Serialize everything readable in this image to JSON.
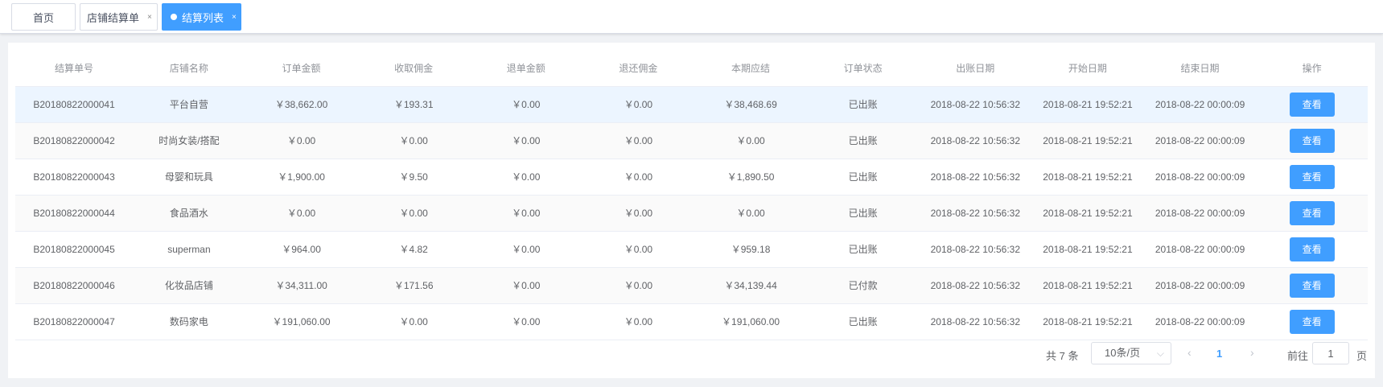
{
  "tabs": [
    {
      "label": "首页"
    },
    {
      "label": "店铺结算单",
      "close": "×"
    },
    {
      "label": "结算列表",
      "close": "×"
    }
  ],
  "table": {
    "headers": [
      "结算单号",
      "店铺名称",
      "订单金额",
      "收取佣金",
      "退单金额",
      "退还佣金",
      "本期应结",
      "订单状态",
      "出账日期",
      "开始日期",
      "结束日期",
      "操作"
    ],
    "rows": [
      [
        "B20180822000041",
        "平台自营",
        "￥38,662.00",
        "￥193.31",
        "￥0.00",
        "￥0.00",
        "￥38,468.69",
        "已出账",
        "2018-08-22 10:56:32",
        "2018-08-21 19:52:21",
        "2018-08-22 00:00:09"
      ],
      [
        "B20180822000042",
        "时尚女装/搭配",
        "￥0.00",
        "￥0.00",
        "￥0.00",
        "￥0.00",
        "￥0.00",
        "已出账",
        "2018-08-22 10:56:32",
        "2018-08-21 19:52:21",
        "2018-08-22 00:00:09"
      ],
      [
        "B20180822000043",
        "母婴和玩具",
        "￥1,900.00",
        "￥9.50",
        "￥0.00",
        "￥0.00",
        "￥1,890.50",
        "已出账",
        "2018-08-22 10:56:32",
        "2018-08-21 19:52:21",
        "2018-08-22 00:00:09"
      ],
      [
        "B20180822000044",
        "食品酒水",
        "￥0.00",
        "￥0.00",
        "￥0.00",
        "￥0.00",
        "￥0.00",
        "已出账",
        "2018-08-22 10:56:32",
        "2018-08-21 19:52:21",
        "2018-08-22 00:00:09"
      ],
      [
        "B20180822000045",
        "superman",
        "￥964.00",
        "￥4.82",
        "￥0.00",
        "￥0.00",
        "￥959.18",
        "已出账",
        "2018-08-22 10:56:32",
        "2018-08-21 19:52:21",
        "2018-08-22 00:00:09"
      ],
      [
        "B20180822000046",
        "化妆品店铺",
        "￥34,311.00",
        "￥171.56",
        "￥0.00",
        "￥0.00",
        "￥34,139.44",
        "已付款",
        "2018-08-22 10:56:32",
        "2018-08-21 19:52:21",
        "2018-08-22 00:00:09"
      ],
      [
        "B20180822000047",
        "数码家电",
        "￥191,060.00",
        "￥0.00",
        "￥0.00",
        "￥0.00",
        "￥191,060.00",
        "已出账",
        "2018-08-22 10:56:32",
        "2018-08-21 19:52:21",
        "2018-08-22 00:00:09"
      ]
    ],
    "view_label": "查看"
  },
  "pager": {
    "total": "共 7 条",
    "page_size": "10条/页",
    "current_page": "1",
    "goto_label": "前往",
    "goto_value": "1",
    "page_suffix": "页"
  },
  "colors": {
    "accent": "#409eff",
    "hover_row": "#ecf5ff"
  }
}
